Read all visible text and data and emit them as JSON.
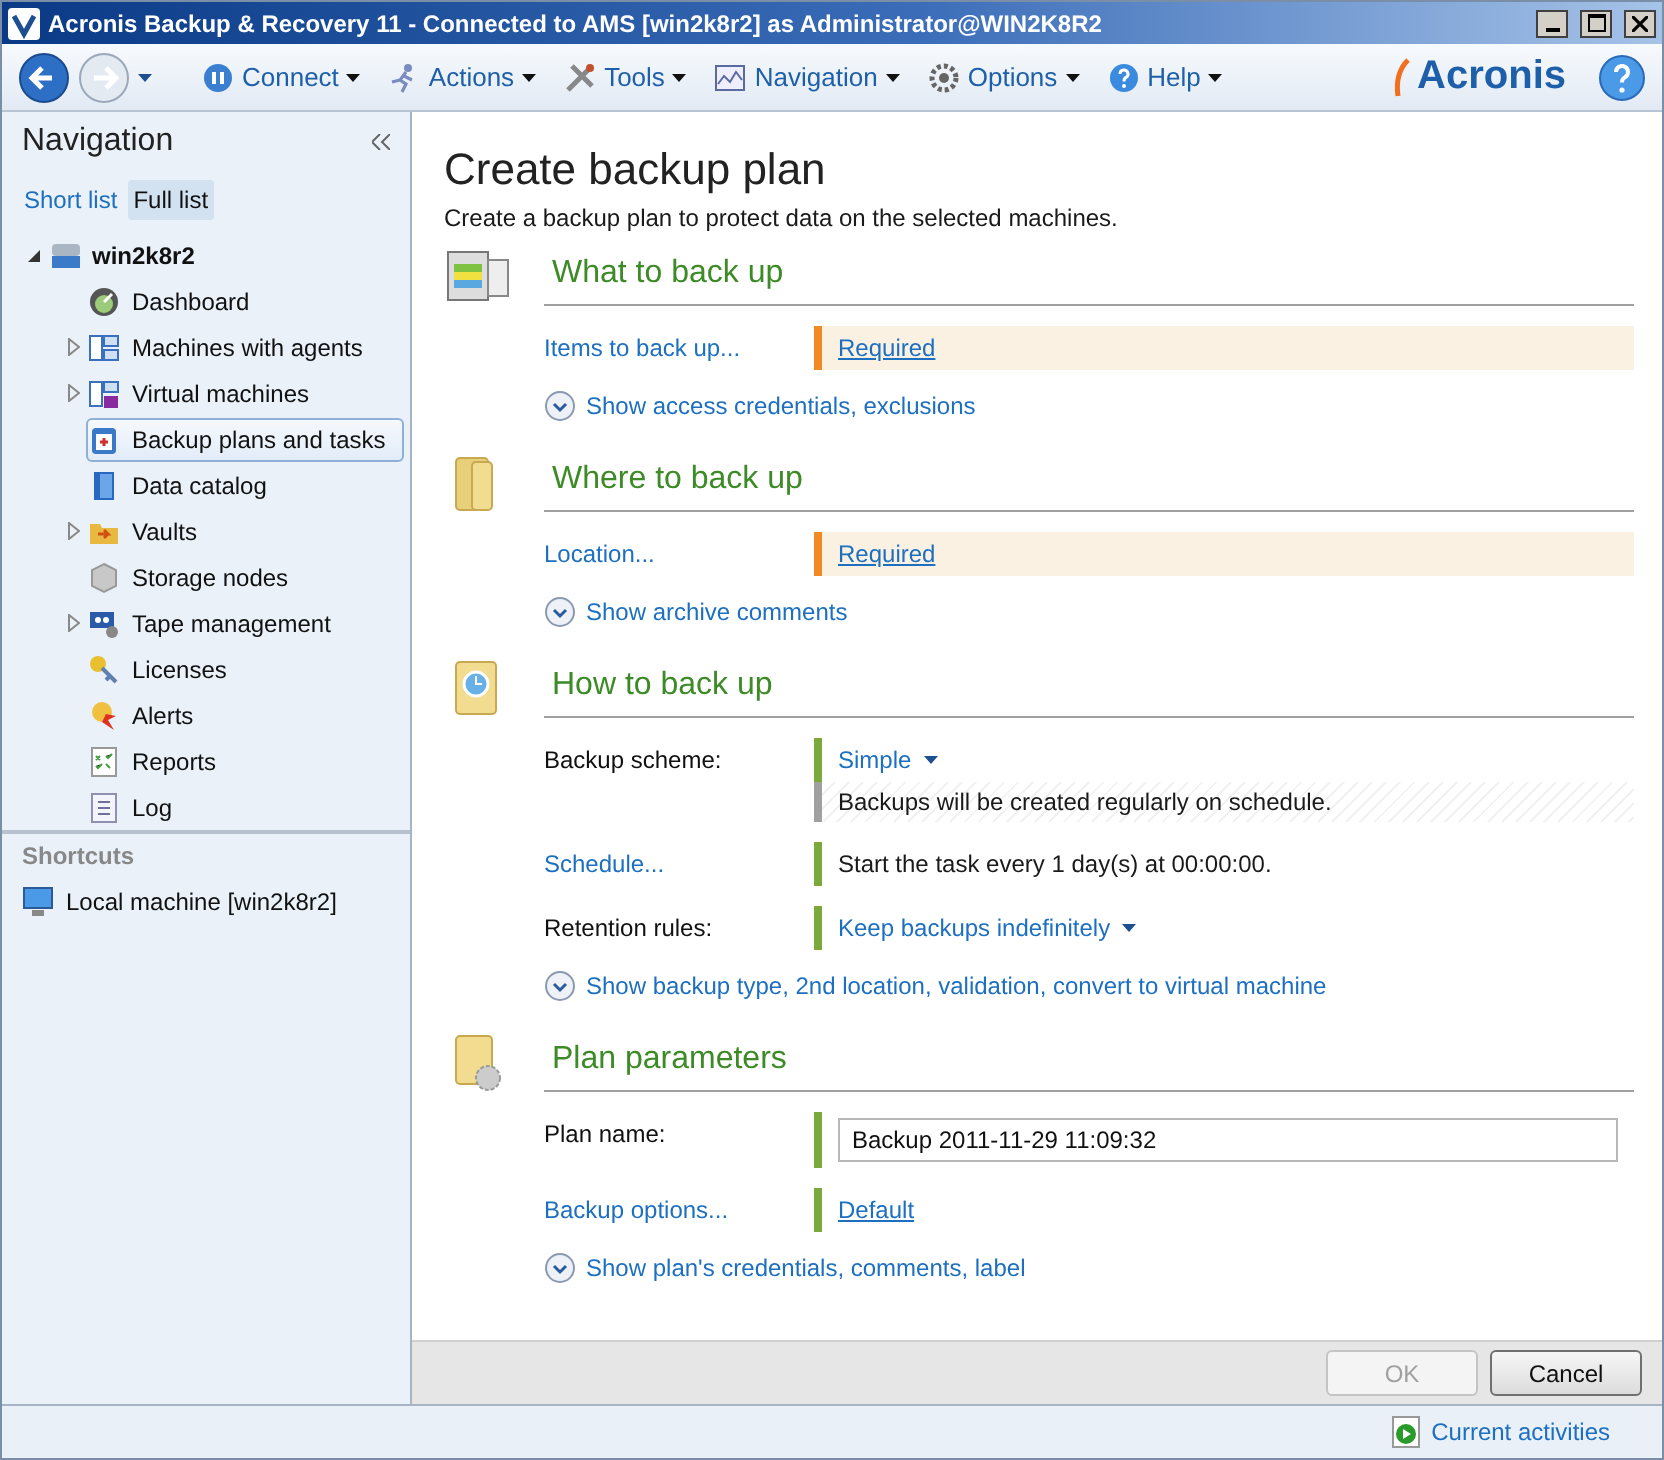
{
  "window": {
    "title": "Acronis Backup & Recovery 11 - Connected to AMS [win2k8r2] as Administrator@WIN2K8R2"
  },
  "toolbar": {
    "menus": [
      {
        "kind": "connect",
        "label": "Connect"
      },
      {
        "kind": "actions",
        "label": "Actions"
      },
      {
        "kind": "tools",
        "label": "Tools"
      },
      {
        "kind": "navigation",
        "label": "Navigation"
      },
      {
        "kind": "options",
        "label": "Options"
      },
      {
        "kind": "help",
        "label": "Help"
      }
    ],
    "logo": "Acronis"
  },
  "navigation": {
    "title": "Navigation",
    "views": [
      {
        "label": "Short list",
        "selected": false
      },
      {
        "label": "Full list",
        "selected": true
      }
    ],
    "tree": [
      {
        "label": "win2k8r2",
        "expanded": true,
        "children": [
          {
            "kind": "dashboard",
            "label": "Dashboard",
            "expandable": false,
            "selected": false
          },
          {
            "kind": "machines",
            "label": "Machines with agents",
            "expandable": true,
            "selected": false
          },
          {
            "kind": "virtual",
            "label": "Virtual machines",
            "expandable": true,
            "selected": false
          },
          {
            "kind": "plans",
            "label": "Backup plans and tasks",
            "expandable": false,
            "selected": true
          },
          {
            "kind": "catalog",
            "label": "Data catalog",
            "expandable": false,
            "selected": false
          },
          {
            "kind": "vaults",
            "label": "Vaults",
            "expandable": true,
            "selected": false
          },
          {
            "kind": "storage",
            "label": "Storage nodes",
            "expandable": false,
            "selected": false
          },
          {
            "kind": "tape",
            "label": "Tape management",
            "expandable": true,
            "selected": false
          },
          {
            "kind": "licenses",
            "label": "Licenses",
            "expandable": false,
            "selected": false
          },
          {
            "kind": "alerts",
            "label": "Alerts",
            "expandable": false,
            "selected": false
          },
          {
            "kind": "reports",
            "label": "Reports",
            "expandable": false,
            "selected": false
          },
          {
            "kind": "log",
            "label": "Log",
            "expandable": false,
            "selected": false
          }
        ]
      }
    ],
    "shortcuts_title": "Shortcuts",
    "shortcuts": [
      "Local machine [win2k8r2]"
    ]
  },
  "main": {
    "title": "Create backup plan",
    "subtitle": "Create a backup plan to protect data on the selected machines.",
    "sections": [
      {
        "kind": "what",
        "title": "What to back up",
        "rows": [
          {
            "label": "Items to back up...",
            "label_link": true,
            "required": true,
            "value": {
              "kind": "link",
              "text": "Required"
            }
          }
        ],
        "expander": "Show access credentials, exclusions"
      },
      {
        "kind": "where",
        "title": "Where to back up",
        "rows": [
          {
            "label": "Location...",
            "label_link": true,
            "required": true,
            "value": {
              "kind": "link",
              "text": "Required"
            }
          }
        ],
        "expander": "Show archive comments"
      },
      {
        "kind": "how",
        "title": "How to back up",
        "rows": [
          {
            "label": "Backup scheme:",
            "label_link": false,
            "required": false,
            "value": {
              "kind": "dropdown",
              "text": "Simple"
            },
            "note": "Backups will be created regularly on schedule."
          },
          {
            "label": "Schedule...",
            "label_link": true,
            "required": false,
            "value": {
              "kind": "text",
              "text": "Start the task every 1 day(s) at 00:00:00."
            }
          },
          {
            "label": "Retention rules:",
            "label_link": false,
            "required": false,
            "value": {
              "kind": "dropdown",
              "text": "Keep backups indefinitely"
            }
          }
        ],
        "expander": "Show backup type, 2nd location, validation, convert to virtual machine"
      },
      {
        "kind": "params",
        "title": "Plan parameters",
        "rows": [
          {
            "label": "Plan name:",
            "label_link": false,
            "required": false,
            "value": {
              "kind": "input",
              "text": "Backup 2011-11-29 11:09:32"
            }
          },
          {
            "label": "Backup options...",
            "label_link": true,
            "required": false,
            "value": {
              "kind": "link",
              "text": "Default"
            }
          }
        ],
        "expander": "Show plan's credentials, comments, label"
      }
    ],
    "buttons": [
      {
        "label": "OK",
        "disabled": true
      },
      {
        "label": "Cancel",
        "disabled": false
      }
    ]
  },
  "status_bar": {
    "activities": "Current activities"
  }
}
